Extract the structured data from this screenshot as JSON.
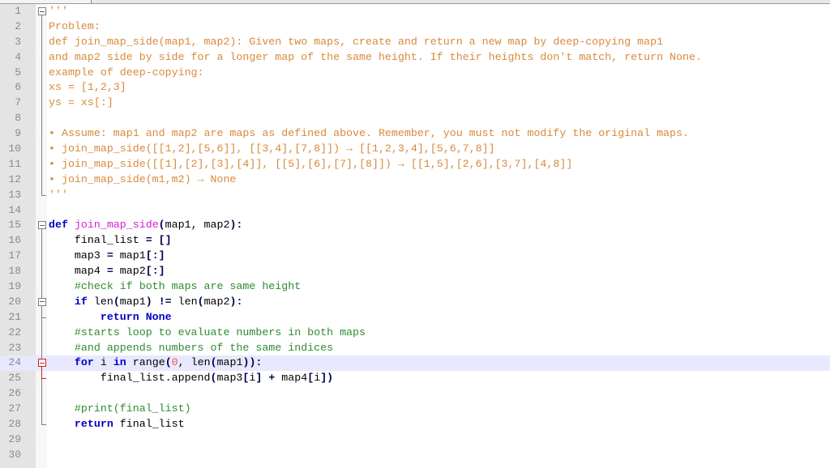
{
  "editor": {
    "colors": {
      "docstring": "#d8893a",
      "keyword": "#0000c8",
      "function_name": "#d020d0",
      "comment": "#2e8b2e",
      "number": "#ff5050",
      "current_line": "#e8e8ff"
    },
    "lines": [
      {
        "n": "1",
        "tokens": [
          {
            "t": "'''",
            "c": "doc"
          }
        ]
      },
      {
        "n": "2",
        "tokens": [
          {
            "t": "Problem:",
            "c": "doc"
          }
        ]
      },
      {
        "n": "3",
        "tokens": [
          {
            "t": "def join_map_side(map1, map2): Given two maps, create and return a new map by deep-copying map1",
            "c": "doc"
          }
        ]
      },
      {
        "n": "4",
        "tokens": [
          {
            "t": "and map2 side by side for a longer map of the same height. If their heights don't match, return None.",
            "c": "doc"
          }
        ]
      },
      {
        "n": "5",
        "tokens": [
          {
            "t": "example of deep-copying:",
            "c": "doc"
          }
        ]
      },
      {
        "n": "6",
        "tokens": [
          {
            "t": "xs = [1,2,3]",
            "c": "doc"
          }
        ]
      },
      {
        "n": "7",
        "tokens": [
          {
            "t": "ys = xs[:]",
            "c": "doc"
          }
        ]
      },
      {
        "n": "8",
        "tokens": []
      },
      {
        "n": "9",
        "tokens": [
          {
            "t": "• Assume: map1 and map2 are maps as defined above. Remember, you must not modify the original maps.",
            "c": "doc"
          }
        ]
      },
      {
        "n": "10",
        "tokens": [
          {
            "t": "• join_map_side([[1,2],[5,6]], [[3,4],[7,8]]) → [[1,2,3,4],[5,6,7,8]]",
            "c": "doc"
          }
        ]
      },
      {
        "n": "11",
        "tokens": [
          {
            "t": "• join_map_side([[1],[2],[3],[4]], [[5],[6],[7],[8]]) → [[1,5],[2,6],[3,7],[4,8]]",
            "c": "doc"
          }
        ]
      },
      {
        "n": "12",
        "tokens": [
          {
            "t": "• join_map_side(m1,m2) → None",
            "c": "doc"
          }
        ]
      },
      {
        "n": "13",
        "tokens": [
          {
            "t": "'''",
            "c": "doc"
          }
        ]
      },
      {
        "n": "14",
        "tokens": []
      },
      {
        "n": "15",
        "tokens": [
          {
            "t": "def",
            "c": "kw"
          },
          {
            "t": " "
          },
          {
            "t": "join_map_side",
            "c": "fn"
          },
          {
            "t": "(",
            "c": "op"
          },
          {
            "t": "map1, map2"
          },
          {
            "t": "):",
            "c": "op"
          }
        ]
      },
      {
        "n": "16",
        "tokens": [
          {
            "t": "    final_list "
          },
          {
            "t": "=",
            "c": "op"
          },
          {
            "t": " "
          },
          {
            "t": "[]",
            "c": "op"
          }
        ]
      },
      {
        "n": "17",
        "tokens": [
          {
            "t": "    map3 "
          },
          {
            "t": "=",
            "c": "op"
          },
          {
            "t": " map1"
          },
          {
            "t": "[:]",
            "c": "op"
          }
        ]
      },
      {
        "n": "18",
        "tokens": [
          {
            "t": "    map4 "
          },
          {
            "t": "=",
            "c": "op"
          },
          {
            "t": " map2"
          },
          {
            "t": "[:]",
            "c": "op"
          }
        ]
      },
      {
        "n": "19",
        "tokens": [
          {
            "t": "    #check if both maps are same height",
            "c": "cm"
          }
        ]
      },
      {
        "n": "20",
        "tokens": [
          {
            "t": "    "
          },
          {
            "t": "if",
            "c": "kw"
          },
          {
            "t": " len"
          },
          {
            "t": "(",
            "c": "op"
          },
          {
            "t": "map1"
          },
          {
            "t": ")",
            "c": "op"
          },
          {
            "t": " "
          },
          {
            "t": "!=",
            "c": "op"
          },
          {
            "t": " len"
          },
          {
            "t": "(",
            "c": "op"
          },
          {
            "t": "map2"
          },
          {
            "t": "):",
            "c": "op"
          }
        ]
      },
      {
        "n": "21",
        "tokens": [
          {
            "t": "        "
          },
          {
            "t": "return None",
            "c": "kw"
          }
        ]
      },
      {
        "n": "22",
        "tokens": [
          {
            "t": "    #starts loop to evaluate numbers in both maps",
            "c": "cm"
          }
        ]
      },
      {
        "n": "23",
        "tokens": [
          {
            "t": "    #and appends numbers of the same indices",
            "c": "cm"
          }
        ]
      },
      {
        "n": "24",
        "current": true,
        "tokens": [
          {
            "t": "    "
          },
          {
            "t": "for",
            "c": "kw"
          },
          {
            "t": " i "
          },
          {
            "t": "in",
            "c": "kw"
          },
          {
            "t": " range"
          },
          {
            "t": "(",
            "c": "op"
          },
          {
            "t": "0",
            "c": "num"
          },
          {
            "t": ", len"
          },
          {
            "t": "(",
            "c": "op"
          },
          {
            "t": "map1"
          },
          {
            "t": ")):",
            "c": "op"
          }
        ]
      },
      {
        "n": "25",
        "tokens": [
          {
            "t": "        final_list.append"
          },
          {
            "t": "(",
            "c": "op"
          },
          {
            "t": "map3"
          },
          {
            "t": "[",
            "c": "op"
          },
          {
            "t": "i"
          },
          {
            "t": "]",
            "c": "op"
          },
          {
            "t": " "
          },
          {
            "t": "+",
            "c": "op"
          },
          {
            "t": " map4"
          },
          {
            "t": "[",
            "c": "op"
          },
          {
            "t": "i"
          },
          {
            "t": "])",
            "c": "op"
          }
        ]
      },
      {
        "n": "26",
        "tokens": []
      },
      {
        "n": "27",
        "tokens": [
          {
            "t": "    #print(final_list)",
            "c": "cm"
          }
        ]
      },
      {
        "n": "28",
        "tokens": [
          {
            "t": "    "
          },
          {
            "t": "return",
            "c": "kw"
          },
          {
            "t": " final_list"
          }
        ]
      },
      {
        "n": "29",
        "tokens": []
      },
      {
        "n": "30",
        "tokens": []
      }
    ]
  }
}
